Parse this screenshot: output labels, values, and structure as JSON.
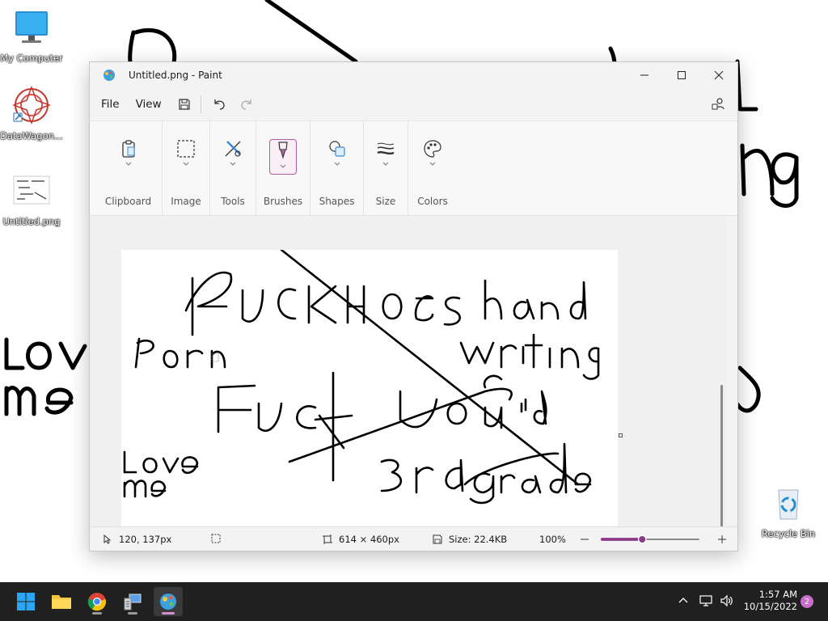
{
  "desktop": {
    "icons": [
      {
        "label": "My Computer"
      },
      {
        "label": "DataWagon..."
      },
      {
        "label": "Untitled.png"
      },
      {
        "label": "Recycle Bin"
      }
    ]
  },
  "window": {
    "title": "Untitled.png - Paint",
    "menu": {
      "file": "File",
      "view": "View"
    },
    "ribbon": {
      "groups": [
        {
          "label": "Clipboard",
          "icon": "clipboard-icon"
        },
        {
          "label": "Image",
          "icon": "selection-icon"
        },
        {
          "label": "Tools",
          "icon": "tools-icon"
        },
        {
          "label": "Brushes",
          "icon": "brush-icon"
        },
        {
          "label": "Shapes",
          "icon": "shapes-icon"
        },
        {
          "label": "Size",
          "icon": "size-icon"
        },
        {
          "label": "Colors",
          "icon": "palette-icon"
        }
      ]
    },
    "status": {
      "cursor": "120, 137px",
      "dimensions": "614 × 460px",
      "size": "Size: 22.4KB",
      "zoom": "100%",
      "zoom_level": 0.42
    }
  },
  "taskbar": {
    "time": "1:57 AM",
    "date": "10/15/2022",
    "notifications": "2"
  },
  "colors": {
    "accent": "#b55e9f",
    "taskbar": "#202020"
  }
}
